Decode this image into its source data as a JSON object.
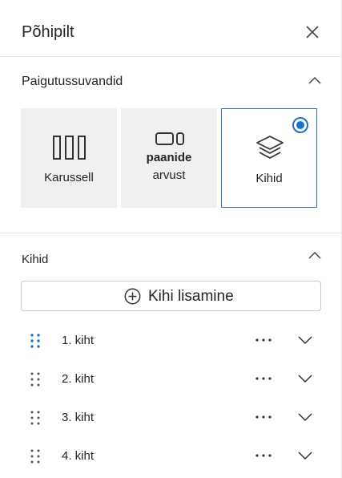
{
  "panel": {
    "title": "Põhipilt",
    "close_icon": "close-icon"
  },
  "layout_section": {
    "title": "Paigutussuvandid",
    "options": [
      {
        "label": "Karussell",
        "icon": "carousel-icon",
        "selected": false
      },
      {
        "label_line1": "paanide",
        "label_line2": "arvust",
        "icon": "tiles-icon",
        "selected": false
      },
      {
        "label": "Kihid",
        "icon": "layers-icon",
        "selected": true
      }
    ]
  },
  "layers_section": {
    "title": "Kihid",
    "add_button_label": "Kihi lisamine",
    "layers": [
      {
        "label": "1. kiht"
      },
      {
        "label": "2. kiht"
      },
      {
        "label": "3. kiht"
      },
      {
        "label": "4. kiht"
      }
    ]
  },
  "colors": {
    "accent": "#1a73c9",
    "selected_border": "#2a6fbd",
    "option_bg": "#f0f0f0",
    "divider": "#e5e5e5"
  }
}
